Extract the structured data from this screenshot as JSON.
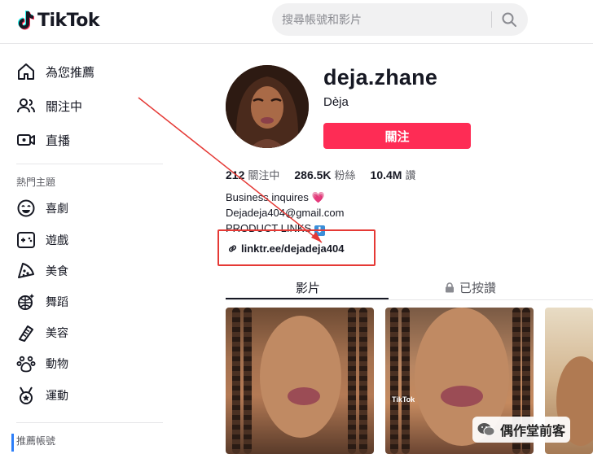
{
  "header": {
    "brand": "TikTok",
    "search_placeholder": "搜尋帳號和影片"
  },
  "sidebar": {
    "nav": [
      {
        "label": "為您推薦",
        "icon": "home-icon"
      },
      {
        "label": "關注中",
        "icon": "following-icon"
      },
      {
        "label": "直播",
        "icon": "live-icon"
      }
    ],
    "topics_title": "熱門主題",
    "topics": [
      {
        "label": "喜劇",
        "icon": "comedy-icon"
      },
      {
        "label": "遊戲",
        "icon": "gaming-icon"
      },
      {
        "label": "美食",
        "icon": "food-icon"
      },
      {
        "label": "舞蹈",
        "icon": "dance-icon"
      },
      {
        "label": "美容",
        "icon": "beauty-icon"
      },
      {
        "label": "動物",
        "icon": "animals-icon"
      },
      {
        "label": "運動",
        "icon": "sports-icon"
      }
    ],
    "suggested_title": "推薦帳號"
  },
  "profile": {
    "username": "deja.zhane",
    "nickname": "Dèja",
    "follow_label": "關注",
    "stats": [
      {
        "value": "212",
        "label": "關注中"
      },
      {
        "value": "286.5K",
        "label": "粉絲"
      },
      {
        "value": "10.4M",
        "label": "讚"
      }
    ],
    "bio": [
      "Business inquires",
      "Dejadeja404@gmail.com",
      "PRODUCT LINKS"
    ],
    "link": "linktr.ee/dejadeja404"
  },
  "tabs": {
    "videos": "影片",
    "liked": "已按讚"
  },
  "video_watermark": "TikTok",
  "watermark": {
    "text": "偶作堂前客"
  },
  "colors": {
    "primary": "#fe2c55",
    "annotation": "#e53935"
  }
}
